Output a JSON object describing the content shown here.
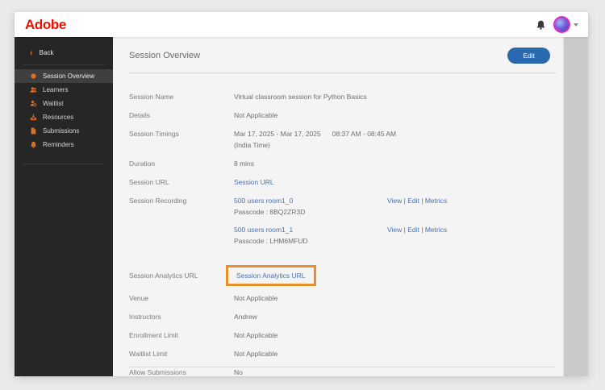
{
  "header": {
    "logo_text": "Adobe",
    "bell_icon": "bell-icon",
    "avatar_icon": "user-avatar",
    "chevron_icon": "chevron-down-icon"
  },
  "sidebar": {
    "back_label": "Back",
    "items": [
      {
        "label": "Session Overview",
        "icon": "session-overview-icon",
        "selected": true
      },
      {
        "label": "Learners",
        "icon": "learners-icon",
        "selected": false
      },
      {
        "label": "Waitlist",
        "icon": "waitlist-icon",
        "selected": false
      },
      {
        "label": "Resources",
        "icon": "resources-icon",
        "selected": false
      },
      {
        "label": "Submissions",
        "icon": "submissions-icon",
        "selected": false
      },
      {
        "label": "Reminders",
        "icon": "reminders-icon",
        "selected": false
      }
    ]
  },
  "main": {
    "title": "Session Overview",
    "edit_button_label": "Edit",
    "rows": [
      {
        "type": "text",
        "label": "Session Name",
        "value": "Virtual classroom session for Python Basics"
      },
      {
        "type": "text",
        "label": "Details",
        "value": "Not Applicable"
      },
      {
        "type": "timings",
        "label": "Session Timings",
        "date_range": "Mar 17, 2025 - Mar 17, 2025",
        "time_range": "08:37 AM - 08:45 AM",
        "timezone": "(India Time)"
      },
      {
        "type": "text",
        "label": "Duration",
        "value": "8 mins"
      },
      {
        "type": "link",
        "label": "Session URL",
        "value": "Session URL",
        "highlighted": false
      },
      {
        "type": "recordings",
        "label": "Session Recording",
        "recordings": [
          {
            "link": "500 users room1_0",
            "passcode": "Passcode : 8BQ2ZR3D",
            "actions": [
              "View",
              "Edit",
              "Metrics"
            ],
            "actions_separator": " | "
          },
          {
            "link": "500 users room1_1",
            "passcode": "Passcode : LHM6MFUD",
            "actions": [
              "View",
              "Edit",
              "Metrics"
            ],
            "actions_separator": " | "
          }
        ]
      },
      {
        "type": "link",
        "label": "Session Analytics URL",
        "value": "Session Analytics URL",
        "highlighted": true
      },
      {
        "type": "text",
        "label": "Venue",
        "value": "Not Applicable"
      },
      {
        "type": "text",
        "label": "Instructors",
        "value": "Andrew"
      },
      {
        "type": "text",
        "label": "Enrollment Limit",
        "value": "Not Applicable"
      },
      {
        "type": "text",
        "label": "Waitlist Limit",
        "value": "Not Applicable"
      },
      {
        "type": "text",
        "label": "Allow Submissions",
        "value": "No"
      }
    ]
  },
  "colors": {
    "adobe_red": "#EB1000",
    "sidebar_icon_orange": "#E0701F",
    "link_blue": "#4A72AD",
    "edit_button_blue": "#2A69AD",
    "highlight_orange": "#E8902C"
  }
}
